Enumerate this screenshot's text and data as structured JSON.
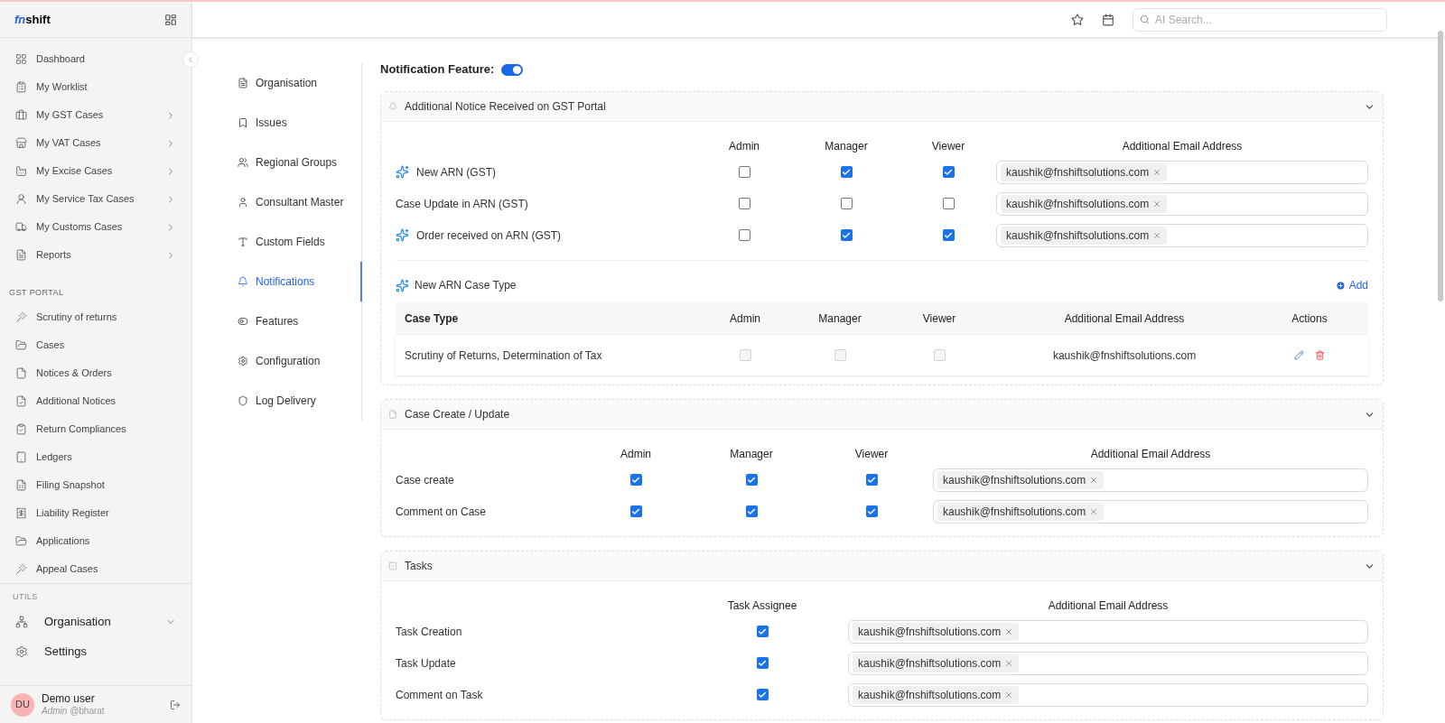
{
  "sidebar": {
    "logo": {
      "mark": "fn",
      "word": "shift"
    },
    "groups": [
      {
        "kind": "compact",
        "items": [
          {
            "label": "Dashboard",
            "submenu": false
          },
          {
            "label": "My Worklist",
            "submenu": false
          },
          {
            "label": "My GST Cases",
            "submenu": true
          },
          {
            "label": "My VAT Cases",
            "submenu": true
          },
          {
            "label": "My Excise Cases",
            "submenu": true
          },
          {
            "label": "My Service Tax Cases",
            "submenu": true
          },
          {
            "label": "My Customs Cases",
            "submenu": true
          },
          {
            "label": "Reports",
            "submenu": true
          }
        ]
      },
      {
        "kind": "compact",
        "heading": "GST PORTAL",
        "items": [
          {
            "label": "Scrutiny of returns"
          },
          {
            "label": "Cases"
          },
          {
            "label": "Notices & Orders"
          },
          {
            "label": "Additional Notices"
          },
          {
            "label": "Return Compliances"
          },
          {
            "label": "Ledgers"
          },
          {
            "label": "Filing Snapshot"
          },
          {
            "label": "Liability Register"
          },
          {
            "label": "Applications"
          },
          {
            "label": "Appeal Cases"
          }
        ]
      },
      {
        "kind": "large",
        "heading": "UTILS",
        "items": [
          {
            "label": "Organisation",
            "submenu": true
          },
          {
            "label": "Settings",
            "submenu": false
          }
        ]
      }
    ],
    "user": {
      "initials": "DU",
      "name": "Demo user",
      "role": "Admin",
      "handle": "@bharat"
    }
  },
  "topbar": {
    "search": {
      "placeholder": "AI Search..."
    }
  },
  "settings_nav": [
    {
      "label": "Organisation",
      "selected": false
    },
    {
      "label": "Issues",
      "selected": false
    },
    {
      "label": "Regional Groups",
      "selected": false
    },
    {
      "label": "Consultant Master",
      "selected": false
    },
    {
      "label": "Custom Fields",
      "selected": false
    },
    {
      "label": "Notifications",
      "selected": true
    },
    {
      "label": "Features",
      "selected": false
    },
    {
      "label": "Configuration",
      "selected": false
    },
    {
      "label": "Log Delivery",
      "selected": false
    }
  ],
  "notification_feature": {
    "label": "Notification Feature:",
    "on": true
  },
  "panels": [
    {
      "title": "Additional Notice Received on GST Portal",
      "expanded": true,
      "columns": [
        "Admin",
        "Manager",
        "Viewer"
      ],
      "email_heading": "Additional Email Address",
      "rows": [
        {
          "label": "New ARN (GST)",
          "sparkle": true,
          "checks": [
            {
              "checked": false
            },
            {
              "checked": true
            },
            {
              "checked": true
            }
          ],
          "emails": [
            "kaushik@fnshiftsolutions.com"
          ]
        },
        {
          "label": "Case Update in ARN (GST)",
          "sparkle": false,
          "checks": [
            {
              "checked": false
            },
            {
              "checked": false
            },
            {
              "checked": false
            }
          ],
          "emails": [
            "kaushik@fnshiftsolutions.com"
          ]
        },
        {
          "label": "Order received on ARN (GST)",
          "sparkle": true,
          "checks": [
            {
              "checked": false
            },
            {
              "checked": true
            },
            {
              "checked": true
            }
          ],
          "emails": [
            "kaushik@fnshiftsolutions.com"
          ]
        }
      ],
      "case_types": {
        "title": "New ARN Case Type",
        "add_label": "Add",
        "columns": [
          "Case Type",
          "Admin",
          "Manager",
          "Viewer",
          "Additional Email Address",
          "Actions"
        ],
        "rows": [
          {
            "case_type": "Scrutiny of Returns, Determination of Tax",
            "checks": [
              {
                "checked": false,
                "disabled": true
              },
              {
                "checked": false,
                "disabled": true
              },
              {
                "checked": false,
                "disabled": true
              }
            ],
            "email": "kaushik@fnshiftsolutions.com"
          }
        ]
      }
    },
    {
      "title": "Case Create / Update",
      "expanded": true,
      "columns": [
        "Admin",
        "Manager",
        "Viewer"
      ],
      "email_heading": "Additional Email Address",
      "rows": [
        {
          "label": "Case create",
          "sparkle": false,
          "checks": [
            {
              "checked": true
            },
            {
              "checked": true
            },
            {
              "checked": true
            }
          ],
          "emails": [
            "kaushik@fnshiftsolutions.com"
          ]
        },
        {
          "label": "Comment on Case",
          "sparkle": false,
          "checks": [
            {
              "checked": true
            },
            {
              "checked": true
            },
            {
              "checked": true
            }
          ],
          "emails": [
            "kaushik@fnshiftsolutions.com"
          ]
        }
      ]
    },
    {
      "title": "Tasks",
      "expanded": true,
      "columns": [
        "Task Assignee"
      ],
      "email_heading": "Additional Email Address",
      "rows": [
        {
          "label": "Task Creation",
          "sparkle": false,
          "checks": [
            {
              "checked": true
            }
          ],
          "emails": [
            "kaushik@fnshiftsolutions.com"
          ]
        },
        {
          "label": "Task Update",
          "sparkle": false,
          "checks": [
            {
              "checked": true
            }
          ],
          "emails": [
            "kaushik@fnshiftsolutions.com"
          ]
        },
        {
          "label": "Comment on Task",
          "sparkle": false,
          "checks": [
            {
              "checked": true
            }
          ],
          "emails": [
            "kaushik@fnshiftsolutions.com"
          ]
        }
      ]
    }
  ]
}
